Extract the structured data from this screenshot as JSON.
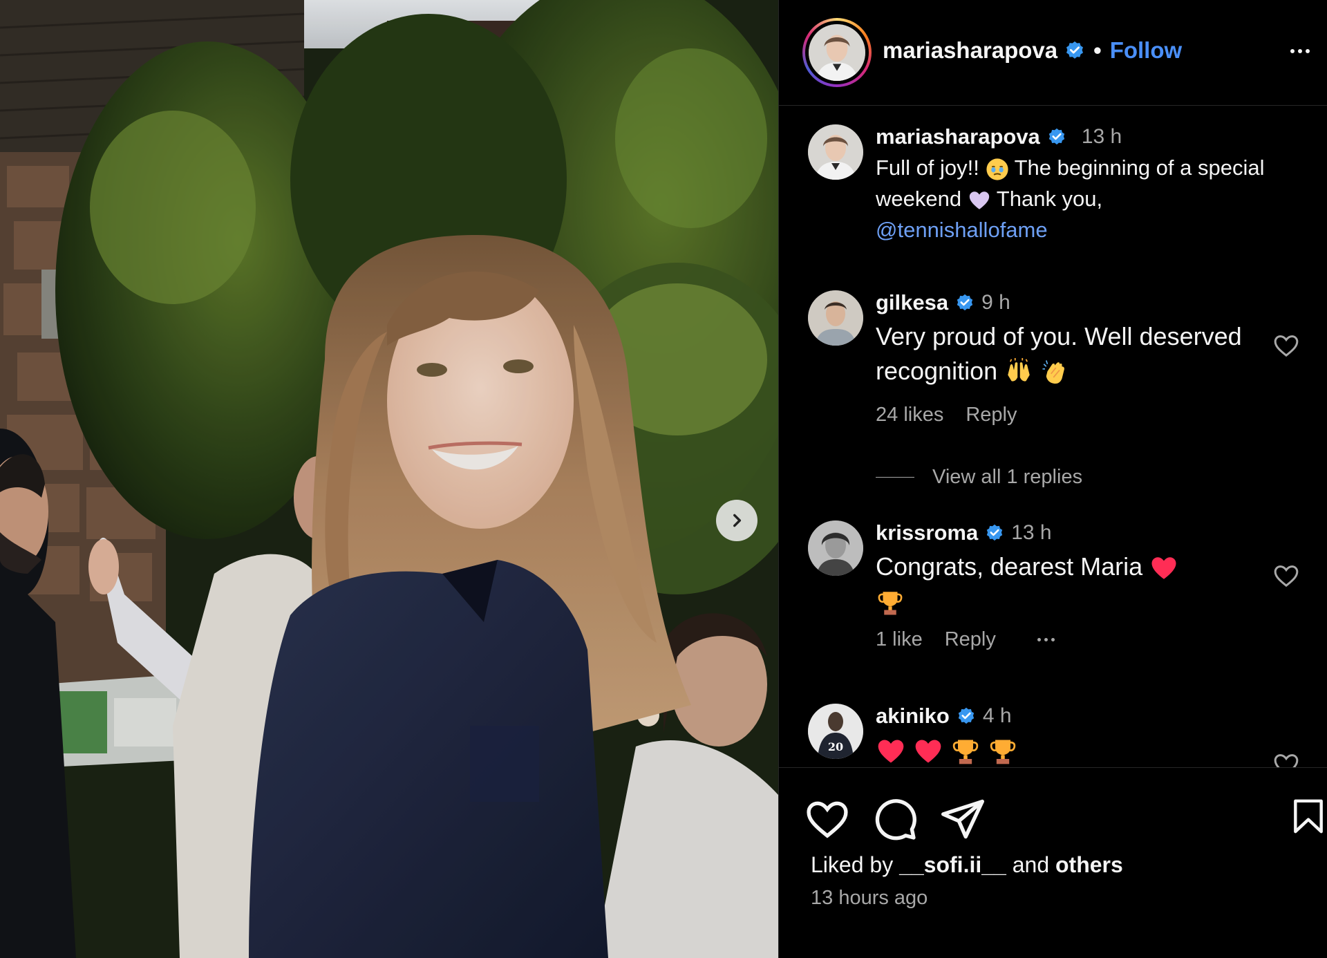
{
  "header": {
    "username": "mariasharapova",
    "separator": "•",
    "follow_label": "Follow"
  },
  "caption": {
    "username": "mariasharapova",
    "time": "13 h",
    "text_part1": "Full of joy!!",
    "text_part2": "The beginning of a special weekend",
    "text_part3": "Thank you,",
    "mention": "@tennishallofame",
    "emoji_1": "face-holding-back-tears-emoji",
    "emoji_2": "white-heart-emoji"
  },
  "comments": [
    {
      "username": "gilkesa",
      "time": "9 h",
      "text": "Very proud of you. Well deserved recognition",
      "emojis": [
        "raising-hands-emoji",
        "clapping-hands-emoji"
      ],
      "likes": "24 likes",
      "reply_label": "Reply",
      "view_replies": "View all 1 replies"
    },
    {
      "username": "krissroma",
      "time": "13 h",
      "text": "Congrats, dearest Maria",
      "emojis": [
        "red-heart-emoji",
        "trophy-emoji"
      ],
      "likes": "1 like",
      "reply_label": "Reply"
    },
    {
      "username": "akiniko",
      "time": "4 h",
      "text": "",
      "emojis": [
        "red-heart-emoji",
        "red-heart-emoji",
        "trophy-emoji",
        "trophy-emoji"
      ]
    }
  ],
  "footer": {
    "liked_by_prefix": "Liked by",
    "liked_by_user": "__sofi.ii__",
    "liked_by_join": "and",
    "liked_by_others": "others",
    "posted": "13 hours ago"
  },
  "colors": {
    "background": "#000000",
    "text": "#f5f5f5",
    "muted": "#a8a8a8",
    "link": "#4a8ff8",
    "mention": "#6ea0f5",
    "verified": "#3897f0",
    "heart": "#ff2d55"
  },
  "icons": {
    "next": "chevron-right-icon",
    "verified": "verified-badge-icon",
    "like": "heart-outline-icon",
    "comment": "comment-bubble-icon",
    "share": "paper-plane-icon",
    "save": "bookmark-icon",
    "more": "more-horizontal-icon"
  }
}
